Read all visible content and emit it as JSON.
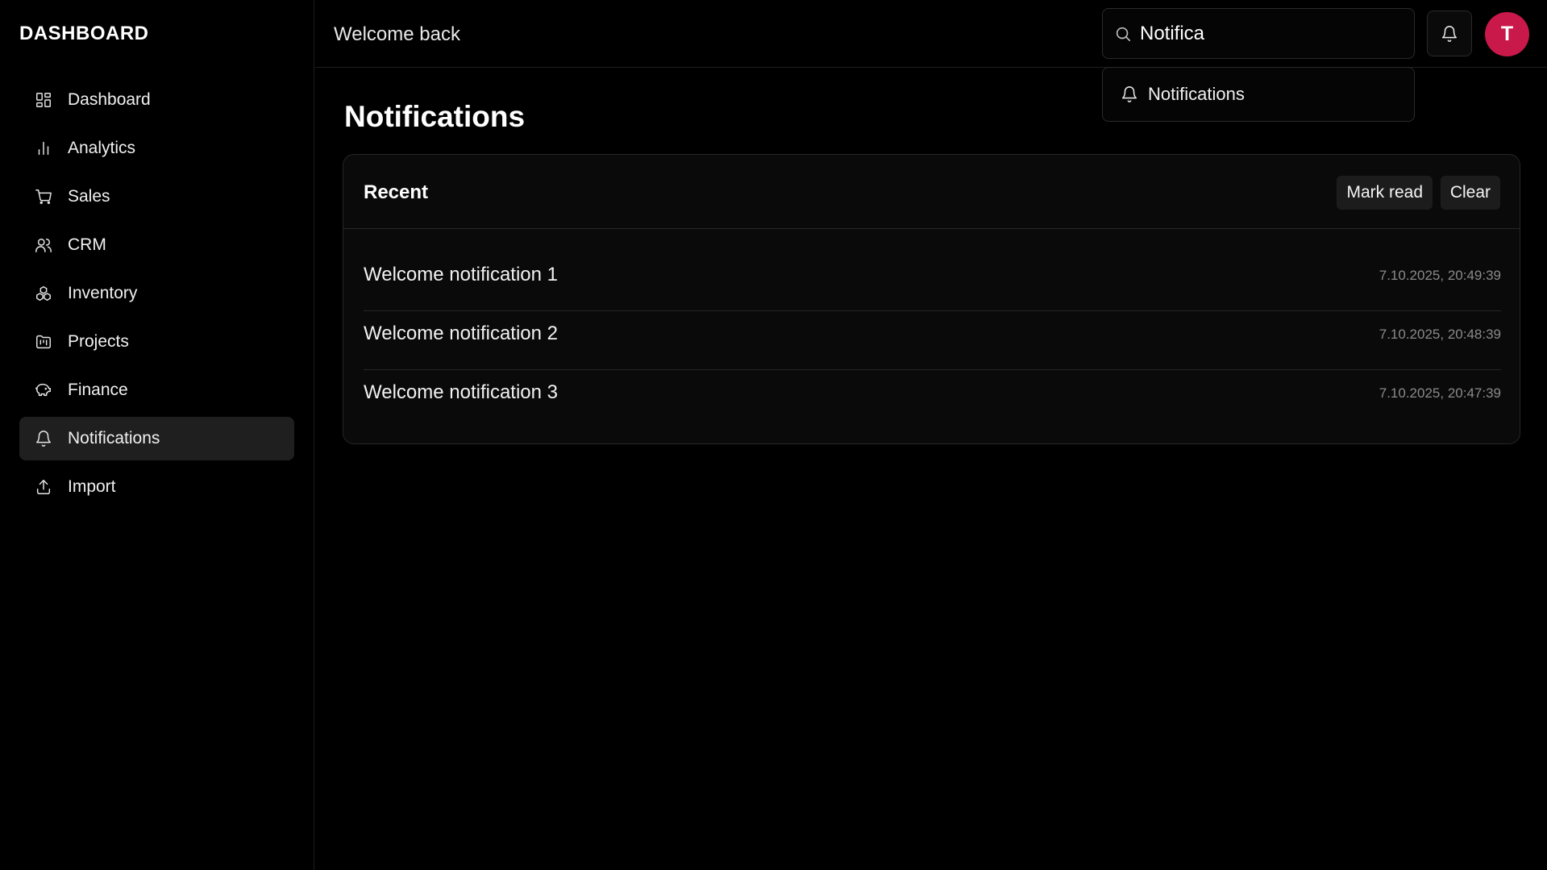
{
  "sidebar": {
    "brand": "DASHBOARD",
    "items": [
      {
        "label": "Dashboard",
        "icon": "dashboard-grid-icon"
      },
      {
        "label": "Analytics",
        "icon": "bar-chart-icon"
      },
      {
        "label": "Sales",
        "icon": "cart-icon"
      },
      {
        "label": "CRM",
        "icon": "users-icon"
      },
      {
        "label": "Inventory",
        "icon": "boxes-icon"
      },
      {
        "label": "Projects",
        "icon": "folder-kanban-icon"
      },
      {
        "label": "Finance",
        "icon": "piggy-bank-icon"
      },
      {
        "label": "Notifications",
        "icon": "bell-icon",
        "active": true
      },
      {
        "label": "Import",
        "icon": "upload-icon"
      }
    ]
  },
  "header": {
    "welcome": "Welcome back",
    "search_value": "Notifica",
    "avatar_initial": "T",
    "avatar_color": "#c9184a"
  },
  "search_dropdown": {
    "items": [
      {
        "label": "Notifications",
        "icon": "bell-icon"
      }
    ]
  },
  "main": {
    "title": "Notifications",
    "card": {
      "title": "Recent",
      "mark_read_label": "Mark read",
      "clear_label": "Clear",
      "notifications": [
        {
          "title": "Welcome notification 1",
          "time": "7.10.2025, 20:49:39"
        },
        {
          "title": "Welcome notification 2",
          "time": "7.10.2025, 20:48:39"
        },
        {
          "title": "Welcome notification 3",
          "time": "7.10.2025, 20:47:39"
        }
      ]
    }
  }
}
